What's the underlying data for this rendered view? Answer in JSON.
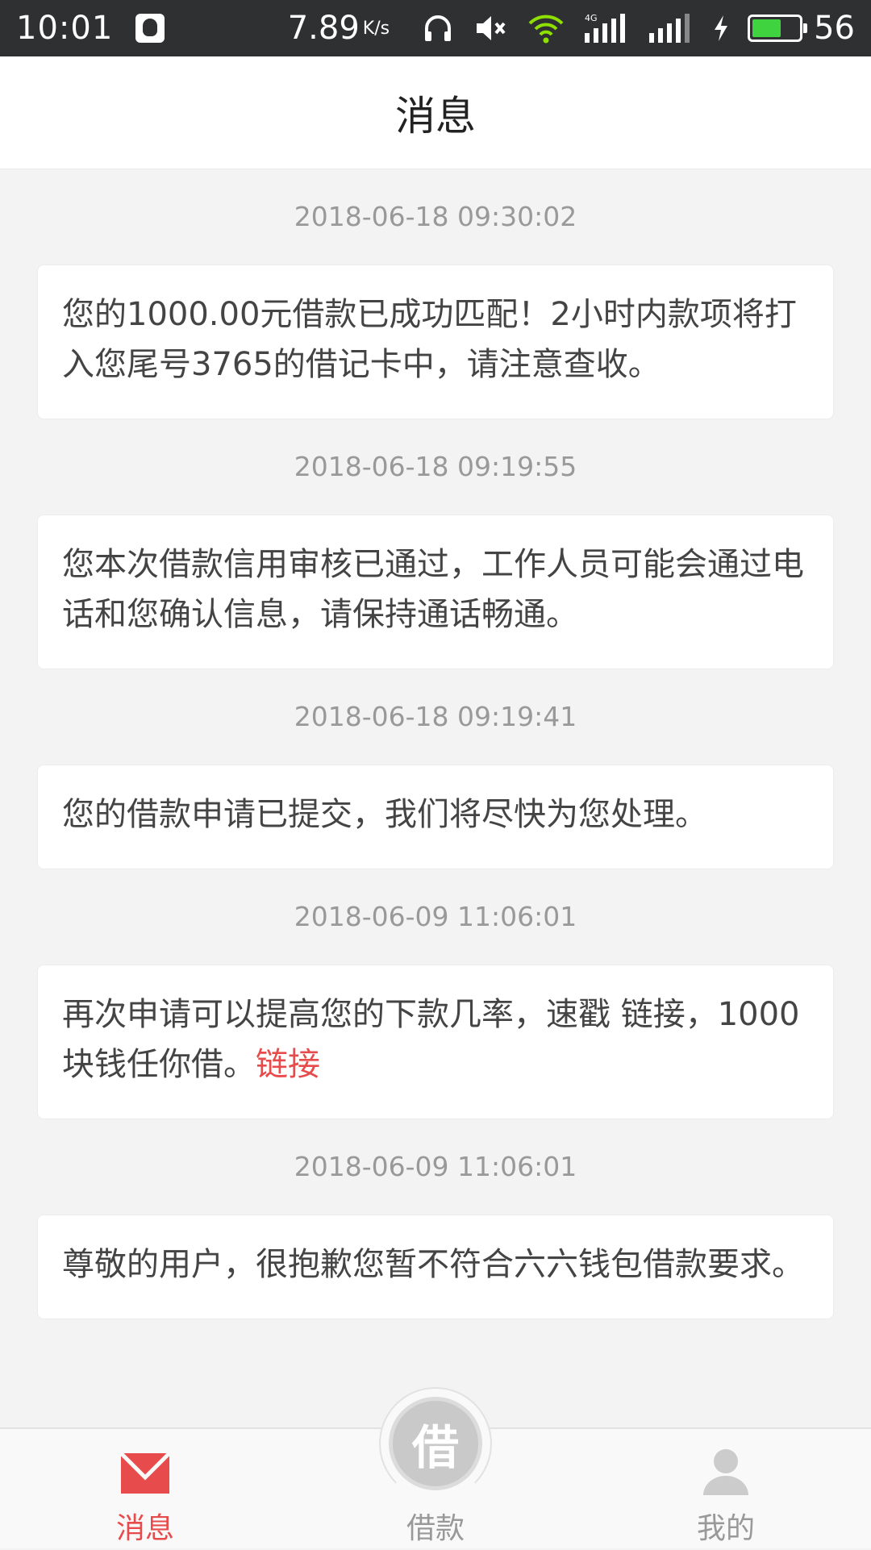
{
  "status_bar": {
    "time": "10:01",
    "speed": "7.89",
    "speed_unit": "K/s",
    "battery": "56"
  },
  "header": {
    "title": "消息"
  },
  "messages": [
    {
      "time": "2018-06-18 09:30:02",
      "text": "您的1000.00元借款已成功匹配！2小时内款项将打入您尾号3765的借记卡中，请注意查收。"
    },
    {
      "time": "2018-06-18 09:19:55",
      "text": "您本次借款信用审核已通过，工作人员可能会通过电话和您确认信息，请保持通话畅通。"
    },
    {
      "time": "2018-06-18 09:19:41",
      "text": "您的借款申请已提交，我们将尽快为您处理。"
    },
    {
      "time": "2018-06-09 11:06:01",
      "text": "再次申请可以提高您的下款几率，速戳 链接，1000块钱任你借。",
      "link": "链接"
    },
    {
      "time": "2018-06-09 11:06:01",
      "text": "尊敬的用户，很抱歉您暂不符合六六钱包借款要求。"
    }
  ],
  "bottom_nav": {
    "messages": "消息",
    "loan": "借款",
    "loan_icon_char": "借",
    "me": "我的"
  },
  "colors": {
    "accent": "#e84b4b",
    "status_bar": "#2f3032",
    "battery": "#3fd43f",
    "wifi": "#8ee000"
  }
}
